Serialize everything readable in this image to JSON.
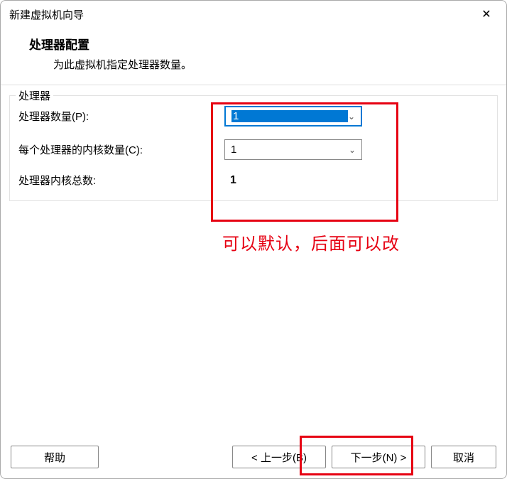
{
  "titlebar": {
    "title": "新建虚拟机向导"
  },
  "header": {
    "title": "处理器配置",
    "subtitle": "为此虚拟机指定处理器数量。"
  },
  "groupbox": {
    "legend": "处理器",
    "processor_count_label": "处理器数量(P):",
    "processor_count_value": "1",
    "cores_per_processor_label": "每个处理器的内核数量(C):",
    "cores_per_processor_value": "1",
    "total_cores_label": "处理器内核总数:",
    "total_cores_value": "1"
  },
  "annotation": {
    "text": "可以默认，后面可以改"
  },
  "footer": {
    "help": "帮助",
    "back": "< 上一步(B)",
    "next": "下一步(N) >",
    "cancel": "取消"
  }
}
